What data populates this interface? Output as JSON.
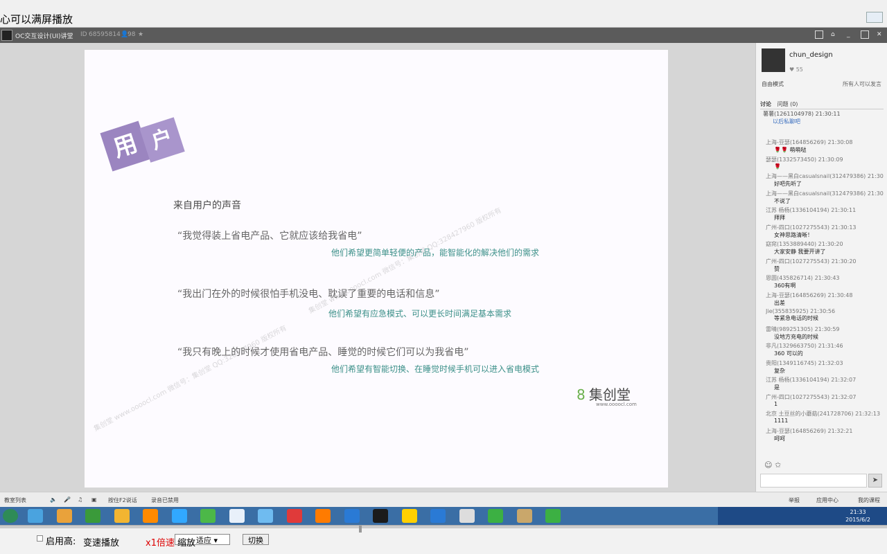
{
  "window": {
    "title": "心可以满屏播放"
  },
  "room": {
    "name": "OC交互设计(UI)讲堂",
    "id_label": "ID",
    "id": "68595814",
    "members": "98"
  },
  "slide": {
    "badge": [
      "用",
      "户"
    ],
    "heading": "来自用户的声音",
    "quotes": [
      {
        "q": "“我觉得装上省电产品、它就应该给我省电”",
        "a": "他们希望更简单轻便的产品，能智能化的解决他们的需求"
      },
      {
        "q": "“我出门在外的时候很怕手机没电、耽误了重要的电话和信息”",
        "a": "他们希望有应急模式、可以更长时间满足基本需求"
      },
      {
        "q": "“我只有晚上的时候才使用省电产品、睡觉的时候它们可以为我省电”",
        "a": "他们希望有智能切换、在睡觉时候手机可以进入省电模式"
      }
    ],
    "watermark": "集创堂 www.oooocl.com 微信号：集创堂 QQ:328427960 版权所有",
    "brand": {
      "glyph": "8",
      "name": "集创堂",
      "url": "www.oooocl.com"
    }
  },
  "sidebar": {
    "host": "chun_design",
    "likes": "55",
    "mode": "自由模式",
    "permission": "所有人可以发言",
    "tabs": [
      "讨论",
      "问题 (0)"
    ],
    "system": {
      "user": "薯薯(1261104978) 21:30:11",
      "link": "以后私聊吧"
    },
    "messages": [
      {
        "who": "上海-豆瑟(164856269) 21:30:08",
        "body": "🌹🌹 萌萌哒"
      },
      {
        "who": "瑟瑟(1332573450) 21:30:09",
        "body": "🌹"
      },
      {
        "who": "上海——黑白casualsnail(312479386) 21:30",
        "body": "好吧先听了"
      },
      {
        "who": "上海——黑白casualsnail(312479386) 21:30",
        "body": "不说了"
      },
      {
        "who": "江苏 杨杨(1336104194) 21:30:11",
        "body": "拜拜"
      },
      {
        "who": "广州-四口(1027275543) 21:30:13",
        "body": "女神思路清晰！"
      },
      {
        "who": "窈窕(1353889440) 21:30:20",
        "body": "大家安静 我要开讲了"
      },
      {
        "who": "广州-四口(1027275543) 21:30:20",
        "body": "赞"
      },
      {
        "who": "恩圆(435826714) 21:30:43",
        "body": "360有啊"
      },
      {
        "who": "上海-豆瑟(164856269) 21:30:48",
        "body": "出差"
      },
      {
        "who": "Jie(355835925) 21:30:56",
        "body": "等紧急电话的时候"
      },
      {
        "who": "雷晴(989251305) 21:30:59",
        "body": "没地方充电的时候"
      },
      {
        "who": "非凡(1329663750) 21:31:46",
        "body": "360 可以的"
      },
      {
        "who": "贵阳(1349116745) 21:32:03",
        "body": "复杂"
      },
      {
        "who": "江苏 杨杨(1336104194) 21:32:07",
        "body": "是"
      },
      {
        "who": "广州-四口(1027275543) 21:32:07",
        "body": "1"
      },
      {
        "who": "北京 土豆丝的小蘑菇(241728706) 21:32:13",
        "body": "1111"
      },
      {
        "who": "上海-豆瑟(164856269) 21:32:21",
        "body": "呵呵"
      }
    ],
    "send": "➤"
  },
  "toolbar": {
    "left": [
      "教室列表",
      "按住F2说话",
      "录音已禁用"
    ],
    "right": [
      "举报",
      "应用中心",
      "我的课程"
    ]
  },
  "taskbar": {
    "icons": [
      "#4aa3df",
      "#e9a23b",
      "#3a9a3a",
      "#f2b531",
      "#ff8a00",
      "#31a8ff",
      "#4cb848",
      "#e8f0fa",
      "#6fbbf0",
      "#e03a3a",
      "#ff7b00",
      "#2a7ad5",
      "#1b1b1b",
      "#ffd000",
      "#2a7ad5",
      "#ddd",
      "#3cb043",
      "#c9a76b",
      "#3cb043"
    ],
    "time": "21:33",
    "date": "2015/6/2"
  },
  "player": {
    "enable": "启用高:",
    "speed_label": "变速播放",
    "speed": "x1倍速",
    "zoom": "缩放",
    "zoom_value": "适应",
    "switch": "切换"
  },
  "colors": {
    "accent": "#9b85c0",
    "answer": "#3c9089",
    "taskbar": "#3a6ea5"
  }
}
